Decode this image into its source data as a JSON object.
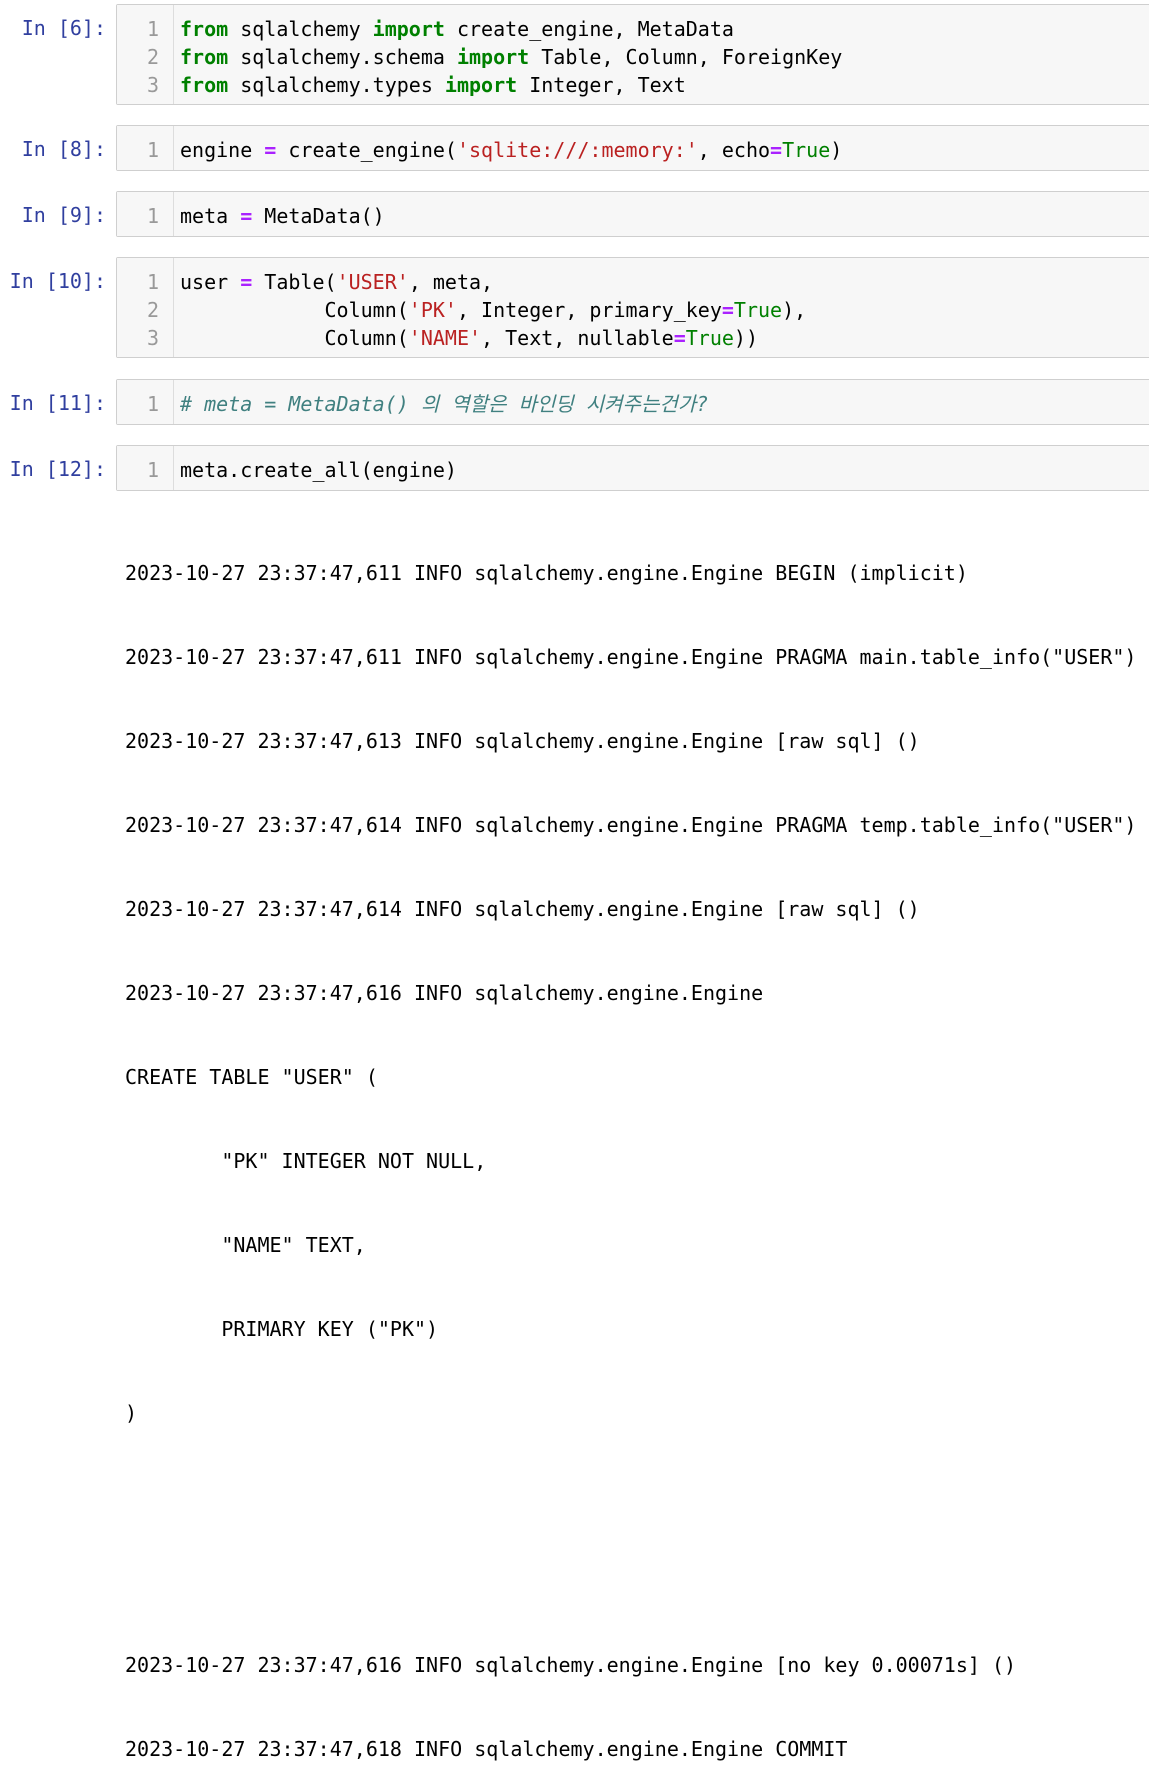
{
  "cells": [
    {
      "prompt": "In [6]:",
      "line_numbers": [
        "1",
        "2",
        "3"
      ],
      "lines": [
        [
          "from",
          " sqlalchemy ",
          "import",
          " create_engine, MetaData"
        ],
        [
          "from",
          " sqlalchemy.schema ",
          "import",
          " Table, Column, ForeignKey"
        ],
        [
          "from",
          " sqlalchemy.types ",
          "import",
          " Integer, Text"
        ]
      ]
    },
    {
      "prompt": "In [8]:",
      "line_numbers": [
        "1"
      ],
      "lines": [
        [
          "engine ",
          "=",
          " create_engine(",
          "'sqlite:///:memory:'",
          ", echo",
          "=",
          "True",
          ")"
        ]
      ]
    },
    {
      "prompt": "In [9]:",
      "line_numbers": [
        "1"
      ],
      "lines": [
        [
          "meta ",
          "=",
          " MetaData()"
        ]
      ]
    },
    {
      "prompt": "In [10]:",
      "line_numbers": [
        "1",
        "2",
        "3"
      ],
      "lines": [
        [
          "user ",
          "=",
          " Table(",
          "'USER'",
          ", meta,"
        ],
        [
          "            Column(",
          "'PK'",
          ", Integer, primary_key",
          "=",
          "True",
          "),"
        ],
        [
          "            Column(",
          "'NAME'",
          ", Text, nullable",
          "=",
          "True",
          "))"
        ]
      ]
    },
    {
      "prompt": "In [11]:",
      "line_numbers": [
        "1"
      ],
      "lines": [
        [
          "# meta = MetaData() 의 역할은 바인딩 시켜주는건가?"
        ]
      ]
    },
    {
      "prompt": "In [12]:",
      "line_numbers": [
        "1"
      ],
      "lines": [
        [
          "meta.create_all(engine)"
        ]
      ]
    }
  ],
  "output_lines": [
    "2023-10-27 23:37:47,611 INFO sqlalchemy.engine.Engine BEGIN (implicit)",
    "2023-10-27 23:37:47,611 INFO sqlalchemy.engine.Engine PRAGMA main.table_info(\"USER\")",
    "2023-10-27 23:37:47,613 INFO sqlalchemy.engine.Engine [raw sql] ()",
    "2023-10-27 23:37:47,614 INFO sqlalchemy.engine.Engine PRAGMA temp.table_info(\"USER\")",
    "2023-10-27 23:37:47,614 INFO sqlalchemy.engine.Engine [raw sql] ()",
    "2023-10-27 23:37:47,616 INFO sqlalchemy.engine.Engine",
    "CREATE TABLE \"USER\" (",
    "        \"PK\" INTEGER NOT NULL,",
    "        \"NAME\" TEXT,",
    "        PRIMARY KEY (\"PK\")",
    ")",
    "",
    "",
    "2023-10-27 23:37:47,616 INFO sqlalchemy.engine.Engine [no key 0.00071s] ()",
    "2023-10-27 23:37:47,618 INFO sqlalchemy.engine.Engine COMMIT"
  ]
}
